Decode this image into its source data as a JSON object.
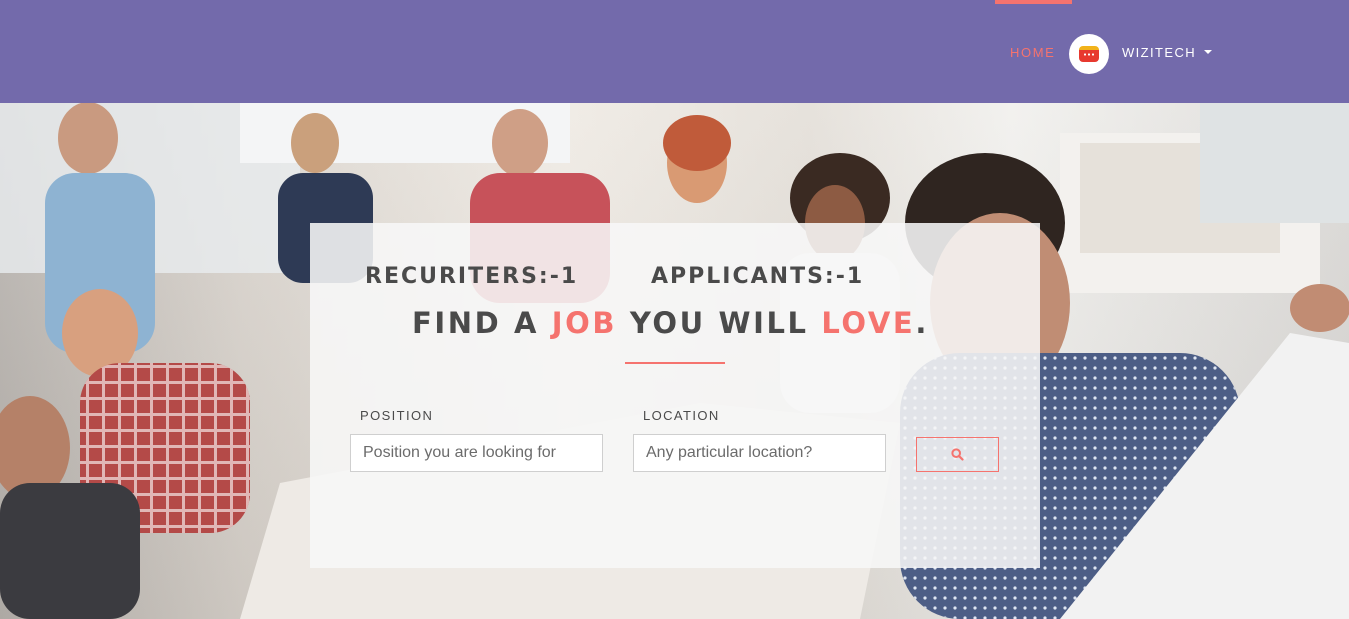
{
  "navbar": {
    "home_label": "HOME",
    "user_name": "WIZITECH",
    "avatar_icon": "chat-bubble-icon",
    "colors": {
      "background": "#736aab",
      "accent": "#f5736e"
    }
  },
  "hero": {
    "recruiters_label": "RECURITERS:-1",
    "applicants_label": "APPLICANTS:-1",
    "headline": {
      "part1": "FIND A ",
      "accent1": "JOB",
      "part2": " YOU WILL ",
      "accent2": "LOVE",
      "part3": "."
    }
  },
  "search": {
    "position_label": "POSITION",
    "position_placeholder": "Position you are looking for",
    "position_value": "",
    "location_label": "LOCATION",
    "location_placeholder": "Any particular location?",
    "location_value": "",
    "button_icon": "search-icon"
  }
}
